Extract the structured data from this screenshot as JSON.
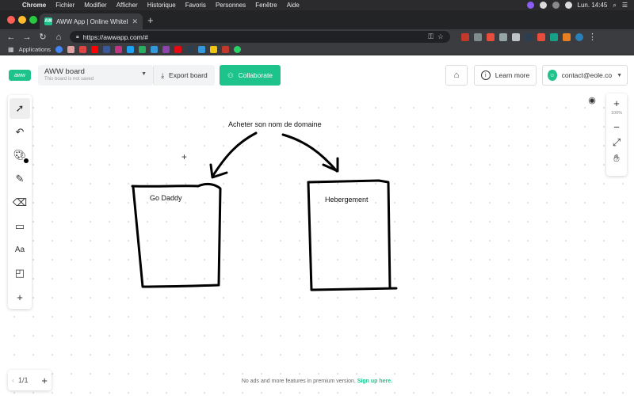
{
  "menubar": {
    "app": "Chrome",
    "items": [
      "Fichier",
      "Modifier",
      "Afficher",
      "Historique",
      "Favoris",
      "Personnes",
      "Fenêtre",
      "Aide"
    ],
    "clock": "Lun. 14:45"
  },
  "tab": {
    "title": "AWW App | Online Whiteboard",
    "favicon": "AW"
  },
  "address": {
    "url": "https://awwapp.com/#"
  },
  "bookmarks": {
    "apps_label": "Applications"
  },
  "header": {
    "board_title": "AWW board",
    "board_subtitle": "This board is not saved",
    "export_label": "Export board",
    "collaborate_label": "Collaborate",
    "learn_label": "Learn more",
    "account_email": "contact@eole.co"
  },
  "canvas": {
    "heading": "Acheter son nom de domaine",
    "box_left_label": "Go Daddy",
    "box_right_label": "Hebergement"
  },
  "zoom": {
    "level": "100%"
  },
  "pagination": {
    "label": "1/1"
  },
  "footer": {
    "note": "No ads and more features in premium version.",
    "signup": "Sign up here."
  },
  "colors": {
    "accent": "#1ec38b",
    "ink": "#000000"
  },
  "icons": {
    "tools": [
      "select-icon",
      "undo-icon",
      "palette-icon",
      "pencil-icon",
      "eraser-icon",
      "rectangle-icon",
      "text-icon",
      "sticky-note-icon",
      "add-icon"
    ],
    "zoom": [
      "eye-icon",
      "zoom-in-icon",
      "zoom-out-icon",
      "fit-icon",
      "hand-icon"
    ]
  }
}
